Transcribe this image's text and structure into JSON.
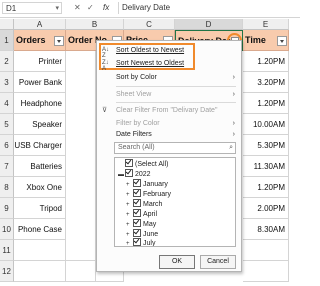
{
  "formula_bar": {
    "name_box": "D1",
    "cancel": "✕",
    "enter": "✓",
    "fx": "fx",
    "value": "Delivary Date"
  },
  "columns": [
    "A",
    "B",
    "C",
    "D",
    "E"
  ],
  "rows": [
    "1",
    "2",
    "3",
    "4",
    "5",
    "6",
    "7",
    "8",
    "9",
    "10",
    "11",
    "12"
  ],
  "headers": {
    "orders": "Orders",
    "order_no": "Order No.",
    "price": "Price",
    "delivery_date": "Delivary Date",
    "time": "Time"
  },
  "data_rows": [
    {
      "order": "Printer",
      "time": "1.20PM"
    },
    {
      "order": "Power Bank",
      "time": "3.20PM"
    },
    {
      "order": "Headphone",
      "time": "1.20PM"
    },
    {
      "order": "Speaker",
      "time": "10.00AM"
    },
    {
      "order": "USB Charger",
      "time": "5.30PM"
    },
    {
      "order": "Batteries",
      "time": "11.30AM"
    },
    {
      "order": "Xbox One",
      "time": "1.20PM"
    },
    {
      "order": "Tripod",
      "time": "2.00PM"
    },
    {
      "order": "Phone Case",
      "time": "8.30AM"
    }
  ],
  "menu": {
    "sort_asc": "Sort Oldest to Newest",
    "sort_desc": "Sort Newest to Oldest",
    "sort_by_color": "Sort by Color",
    "sheet_view": "Sheet View",
    "clear_filter": "Clear Filter From \"Delivary Date\"",
    "filter_by_color": "Filter by Color",
    "date_filters": "Date Filters",
    "search_placeholder": "Search (All)",
    "select_all": "(Select All)",
    "year": "2022",
    "months": [
      "January",
      "February",
      "March",
      "April",
      "May",
      "June",
      "July"
    ],
    "ok": "OK",
    "cancel": "Cancel"
  },
  "colors": {
    "header_fill": "#f8cbad",
    "highlight": "#f08a2c"
  }
}
